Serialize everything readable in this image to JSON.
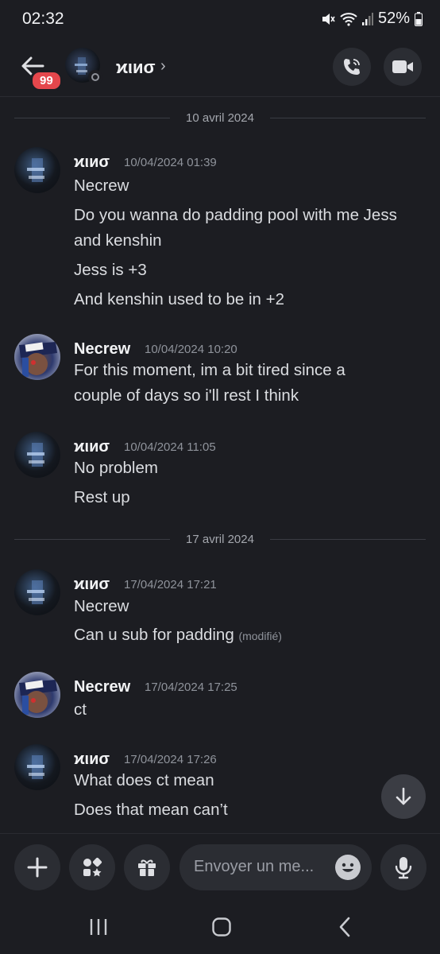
{
  "status_bar": {
    "time": "02:32",
    "battery": "52%"
  },
  "header": {
    "unread_count": "99",
    "name": "ϰιиσ",
    "chevron": "›",
    "icons": {
      "back": "arrow-left-icon",
      "call": "phone-call-icon",
      "video": "video-camera-icon"
    }
  },
  "date_separators": [
    "10 avril 2024",
    "17 avril 2024"
  ],
  "messages": [
    {
      "author": "ϰιиσ",
      "time": "10/04/2024 01:39",
      "lines": [
        "Necrew",
        "Do you wanna do padding pool with me Jess",
        "and kenshin",
        "Jess is +3",
        "And kenshin used to be in +2"
      ]
    },
    {
      "author": "Necrew",
      "time": "10/04/2024 10:20",
      "lines": [
        "For this moment, im a bit tired since a",
        "couple of days so i'll rest I think"
      ]
    },
    {
      "author": "ϰιиσ",
      "time": "10/04/2024 11:05",
      "lines": [
        "No problem",
        "Rest up"
      ]
    },
    {
      "author": "ϰιиσ",
      "time": "17/04/2024 17:21",
      "lines": [
        "Necrew",
        "Can u sub for padding"
      ],
      "edited": "(modifié)"
    },
    {
      "author": "Necrew",
      "time": "17/04/2024 17:25",
      "lines": [
        "ct"
      ]
    },
    {
      "author": "ϰιиσ",
      "time": "17/04/2024 17:26",
      "lines": [
        "What does ct mean",
        "Does that mean can’t"
      ]
    }
  ],
  "composer": {
    "placeholder": "Envoyer un me...",
    "icons": [
      "plus-icon",
      "apps-icon",
      "gift-icon",
      "emoji-icon",
      "microphone-icon"
    ]
  },
  "navbar": {
    "icons": [
      "recent-apps-icon",
      "home-icon",
      "back-nav-icon"
    ]
  },
  "colors": {
    "background": "#1c1d22",
    "badge": "#e5474c",
    "button": "#2b2d33"
  }
}
